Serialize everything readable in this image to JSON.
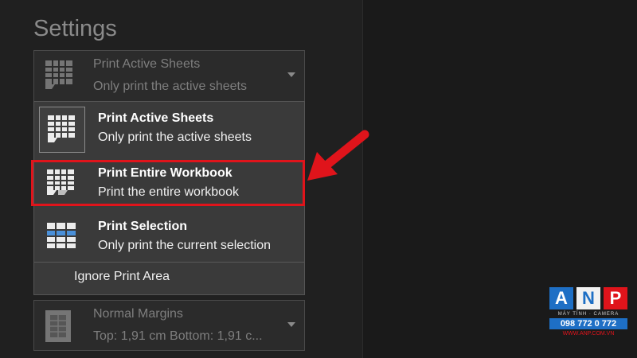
{
  "settings": {
    "title": "Settings"
  },
  "print_what": {
    "selected_title": "Print Active Sheets",
    "selected_desc": "Only print the active sheets",
    "options": [
      {
        "title": "Print Active Sheets",
        "desc": "Only print the active sheets",
        "icon": "active-sheets-icon"
      },
      {
        "title": "Print Entire Workbook",
        "desc": "Print the entire workbook",
        "icon": "entire-workbook-icon"
      },
      {
        "title": "Print Selection",
        "desc": "Only print the current selection",
        "icon": "selection-icon"
      }
    ],
    "ignore_print_area": "Ignore Print Area"
  },
  "margins": {
    "title": "Normal Margins",
    "desc": "Top: 1,91 cm Bottom: 1,91 c..."
  },
  "watermark": {
    "letters": [
      "A",
      "N",
      "P"
    ],
    "subtitle": "MÁY TÍNH · CAMERA",
    "phone": "098 772 0 772",
    "url": "WWW.ANP.COM.VN"
  },
  "colors": {
    "highlight": "#e0141b",
    "brand_blue": "#1e6fc5"
  }
}
